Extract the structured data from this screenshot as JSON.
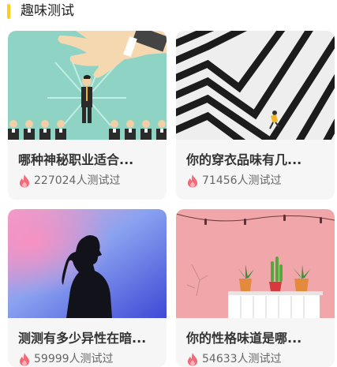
{
  "section": {
    "title": "趣味测试"
  },
  "colors": {
    "accent": "#ffcc1f",
    "flame": "#f06a78"
  },
  "cards": [
    {
      "title": "哪种神秘职业适合...",
      "count_text": "227024人测试过",
      "image": "hand-picking-businessman-image"
    },
    {
      "title": "你的穿衣品味有几...",
      "count_text": "71456人测试过",
      "image": "zebra-crossing-walker-image"
    },
    {
      "title": "测测有多少异性在暗...",
      "count_text": "59999人测试过",
      "image": "silhouette-woman-image"
    },
    {
      "title": "你的性格味道是哪...",
      "count_text": "54633人测试过",
      "image": "potted-plants-pink-wall-image"
    }
  ],
  "icons": {
    "count": "flame-icon"
  }
}
